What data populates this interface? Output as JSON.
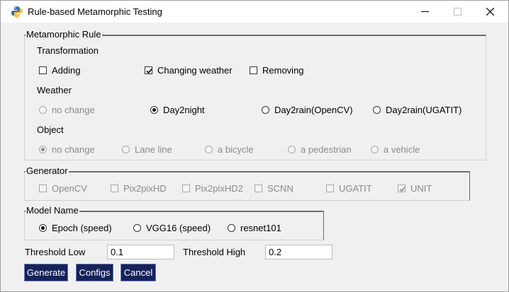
{
  "window": {
    "title": "Rule-based Metamorphic Testing"
  },
  "metamorphic_rule": {
    "legend": "Metamorphic Rule",
    "transformation": {
      "label": "Transformation",
      "options": [
        {
          "label": "Adding",
          "checked": false
        },
        {
          "label": "Changing weather",
          "checked": true
        },
        {
          "label": "Removing",
          "checked": false
        }
      ]
    },
    "weather": {
      "label": "Weather",
      "options": [
        {
          "label": "no change",
          "selected": false,
          "enabled": false
        },
        {
          "label": "Day2night",
          "selected": true,
          "enabled": true
        },
        {
          "label": "Day2rain(OpenCV)",
          "selected": false,
          "enabled": true
        },
        {
          "label": "Day2rain(UGATIT)",
          "selected": false,
          "enabled": true
        }
      ]
    },
    "object": {
      "label": "Object",
      "options": [
        {
          "label": "no change",
          "selected": true,
          "enabled": false
        },
        {
          "label": "Lane line",
          "selected": false,
          "enabled": false
        },
        {
          "label": "a bicycle",
          "selected": false,
          "enabled": false
        },
        {
          "label": "a pedestrian",
          "selected": false,
          "enabled": false
        },
        {
          "label": "a vehicle",
          "selected": false,
          "enabled": false
        }
      ]
    }
  },
  "generator": {
    "legend": "Generator",
    "options": [
      {
        "label": "OpenCV",
        "checked": false
      },
      {
        "label": "Pix2pixHD",
        "checked": false
      },
      {
        "label": "Pix2pixHD2",
        "checked": false
      },
      {
        "label": "SCNN",
        "checked": false
      },
      {
        "label": "UGATIT",
        "checked": false
      },
      {
        "label": "UNIT",
        "checked": true
      }
    ]
  },
  "model_name": {
    "legend": "Model Name",
    "options": [
      {
        "label": "Epoch (speed)",
        "selected": true
      },
      {
        "label": "VGG16 (speed)",
        "selected": false
      },
      {
        "label": "resnet101",
        "selected": false
      }
    ]
  },
  "threshold": {
    "low_label": "Threshold Low",
    "low_value": "0.1",
    "high_label": "Threshold High",
    "high_value": "0.2"
  },
  "buttons": {
    "generate": "Generate",
    "configs": "Configs",
    "cancel": "Cancel"
  },
  "colors": {
    "button_bg": "#15235a",
    "window_bg": "#f0f0f0",
    "disabled_text": "#8a8a8a"
  }
}
